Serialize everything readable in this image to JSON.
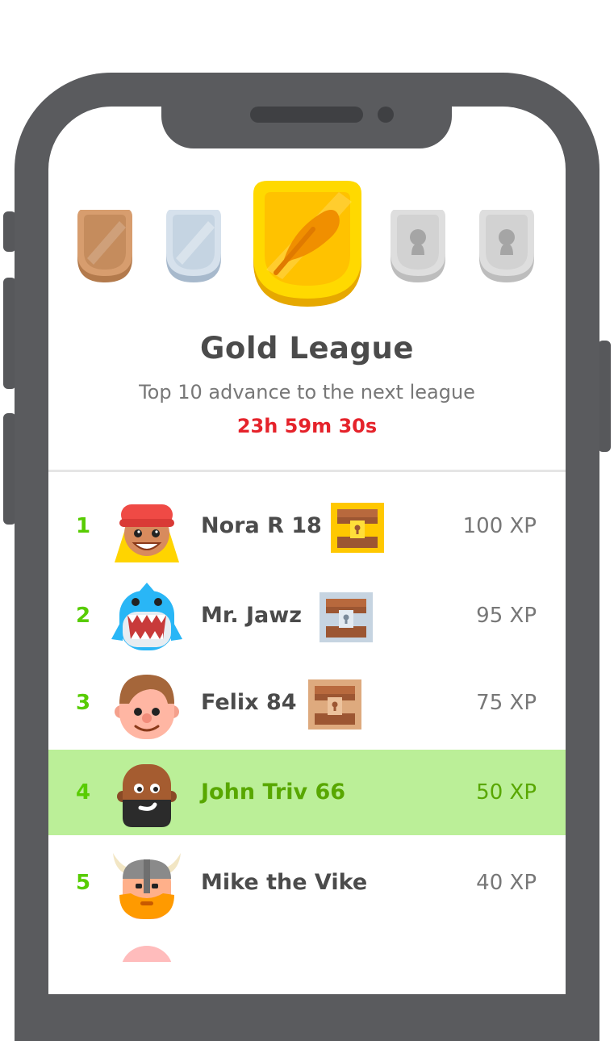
{
  "league": {
    "title": "Gold League",
    "subtitle": "Top 10 advance to the next league",
    "timer": "23h 59m 30s",
    "badges": [
      {
        "name": "bronze",
        "color": "#cd9a6e",
        "state": "unlocked"
      },
      {
        "name": "silver",
        "color": "#c6d4e1",
        "state": "unlocked"
      },
      {
        "name": "gold",
        "color": "#ffc800",
        "state": "current"
      },
      {
        "name": "locked-4",
        "color": "#d9d9d9",
        "state": "locked"
      },
      {
        "name": "locked-5",
        "color": "#d9d9d9",
        "state": "locked"
      }
    ]
  },
  "leaderboard": {
    "rows": [
      {
        "rank": "1",
        "name": "Nora R 18",
        "xp": "100 XP",
        "chest": "gold",
        "avatar": "nora-avatar",
        "highlight": false
      },
      {
        "rank": "2",
        "name": "Mr. Jawz",
        "xp": "95 XP",
        "chest": "silver",
        "avatar": "shark-avatar",
        "highlight": false
      },
      {
        "rank": "3",
        "name": "Felix 84",
        "xp": "75 XP",
        "chest": "bronze",
        "avatar": "felix-avatar",
        "highlight": false
      },
      {
        "rank": "4",
        "name": "John Triv 66",
        "xp": "50 XP",
        "chest": null,
        "avatar": "john-avatar",
        "highlight": true
      },
      {
        "rank": "5",
        "name": "Mike the Vike",
        "xp": "40 XP",
        "chest": null,
        "avatar": "viking-avatar",
        "highlight": false
      }
    ]
  },
  "colors": {
    "rank_green": "#58cc02",
    "highlight_row": "#bbef98",
    "timer_red": "#e5232b",
    "gold": "#ffc800"
  }
}
